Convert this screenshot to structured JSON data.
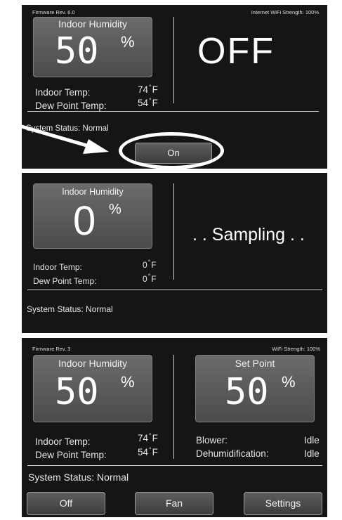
{
  "panel1": {
    "firmware": "Firmware Rev. 6.0",
    "wifi": "Internet WiFi Strength: 100%",
    "humidity_title": "Indoor Humidity",
    "humidity_value": "50",
    "percent": "%",
    "power_state": "OFF",
    "indoor_temp_label": "Indoor Temp:",
    "indoor_temp_value": "74",
    "dew_point_label": "Dew Point Temp:",
    "dew_point_value": "54",
    "unit": "F",
    "degree": "°",
    "status_label": "System Status:",
    "status_value": "Normal",
    "on_button": "On"
  },
  "panel2": {
    "humidity_title": "Indoor Humidity",
    "humidity_value": "0",
    "percent": "%",
    "sampling_text": ". . Sampling . .",
    "indoor_temp_label": "Indoor Temp:",
    "indoor_temp_value": "0",
    "dew_point_label": "Dew Point Temp:",
    "dew_point_value": "0",
    "unit": "F",
    "degree": "°",
    "status_label": "System Status:",
    "status_value": "Normal"
  },
  "panel3": {
    "firmware": "Firmware Rev. 3",
    "wifi": "WiFi Strength: 100%",
    "humidity_title": "Indoor Humidity",
    "humidity_value": "50",
    "percent": "%",
    "setpoint_title": "Set Point",
    "setpoint_value": "50",
    "indoor_temp_label": "Indoor Temp:",
    "indoor_temp_value": "74",
    "dew_point_label": "Dew Point Temp:",
    "dew_point_value": "54",
    "unit": "F",
    "degree": "°",
    "blower_label": "Blower:",
    "blower_value": "Idle",
    "dehum_label": "Dehumidification:",
    "dehum_value": "Idle",
    "status_label": "System Status:",
    "status_value": "Normal",
    "buttons": [
      "Off",
      "Fan",
      "Settings"
    ]
  }
}
